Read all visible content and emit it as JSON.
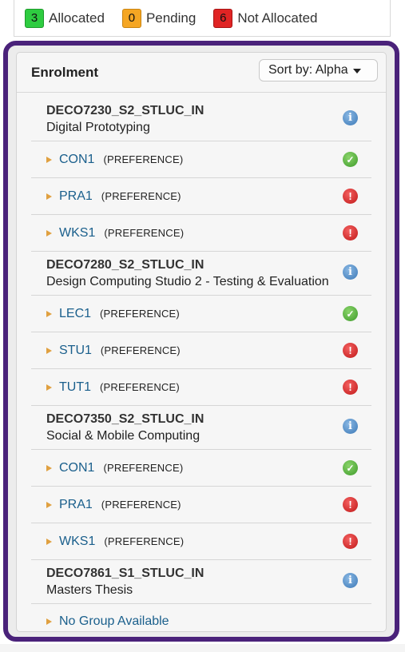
{
  "legend": {
    "allocated": {
      "count": "3",
      "label": "Allocated",
      "color": "#2ecc40"
    },
    "pending": {
      "count": "0",
      "label": "Pending",
      "color": "#f5a623"
    },
    "not_allocated": {
      "count": "6",
      "label": "Not Allocated",
      "color": "#e02424"
    }
  },
  "panel": {
    "title": "Enrolment",
    "sort_label": "Sort by: Alpha"
  },
  "courses": [
    {
      "code": "DECO7230_S2_STLUC_IN",
      "name": "Digital Prototyping",
      "groups": [
        {
          "name": "CON1",
          "tag": "(PREFERENCE)",
          "status": "allocated"
        },
        {
          "name": "PRA1",
          "tag": "(PREFERENCE)",
          "status": "not-allocated"
        },
        {
          "name": "WKS1",
          "tag": "(PREFERENCE)",
          "status": "not-allocated"
        }
      ]
    },
    {
      "code": "DECO7280_S2_STLUC_IN",
      "name": "Design Computing Studio 2 - Testing & Evaluation",
      "groups": [
        {
          "name": "LEC1",
          "tag": "(PREFERENCE)",
          "status": "allocated"
        },
        {
          "name": "STU1",
          "tag": "(PREFERENCE)",
          "status": "not-allocated"
        },
        {
          "name": "TUT1",
          "tag": "(PREFERENCE)",
          "status": "not-allocated"
        }
      ]
    },
    {
      "code": "DECO7350_S2_STLUC_IN",
      "name": "Social & Mobile Computing",
      "groups": [
        {
          "name": "CON1",
          "tag": "(PREFERENCE)",
          "status": "allocated"
        },
        {
          "name": "PRA1",
          "tag": "(PREFERENCE)",
          "status": "not-allocated"
        },
        {
          "name": "WKS1",
          "tag": "(PREFERENCE)",
          "status": "not-allocated"
        }
      ]
    },
    {
      "code": "DECO7861_S1_STLUC_IN",
      "name": "Masters Thesis",
      "no_group": "No Group Available"
    }
  ],
  "icons": {
    "info": "info-icon",
    "allocated": "check-circle-icon",
    "not_allocated": "exclamation-circle-icon",
    "arrow": "triangle-right-icon",
    "sort_caret": "caret-down-icon"
  }
}
